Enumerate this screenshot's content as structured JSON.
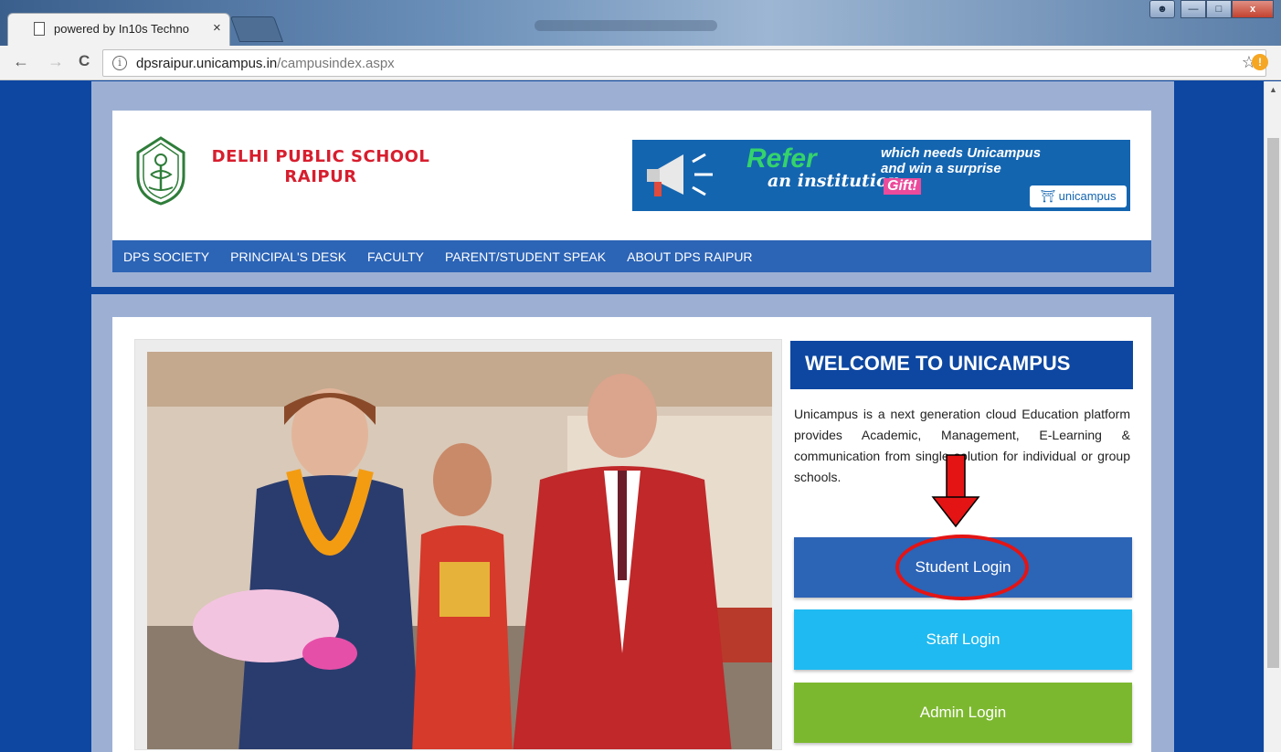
{
  "browser": {
    "tab_title": "powered by In10s Techno",
    "tab_close": "×",
    "url_domain": "dpsraipur.unicampus.in",
    "url_path": "/campusindex.aspx",
    "back": "←",
    "forward": "→",
    "reload": "C",
    "star": "☆",
    "alert": "!"
  },
  "header": {
    "school_line1": "DELHI PUBLIC SCHOOL",
    "school_line2": "RAIPUR"
  },
  "banner": {
    "refer": "Refer",
    "institution": "an institution",
    "line1": "which needs Unicampus",
    "line2": "and win a surprise",
    "gift": "Gift!",
    "brand": "unicampus"
  },
  "nav": [
    "DPS SOCIETY",
    "PRINCIPAL'S DESK",
    "FACULTY",
    "PARENT/STUDENT SPEAK",
    "ABOUT DPS RAIPUR"
  ],
  "welcome": {
    "title": "WELCOME TO UNICAMPUS",
    "description": "Unicampus is a next generation cloud Education platform provides Academic, Management, E-Learning & communication from single solution for individual or group schools."
  },
  "buttons": {
    "student": "Student Login",
    "staff": "Staff Login",
    "admin": "Admin Login"
  },
  "colors": {
    "page_bg": "#0d47a1",
    "panel": "#9db0d4",
    "nav": "#2c64b6",
    "student_btn": "#2c64b6",
    "staff_btn": "#1fbaf1",
    "admin_btn": "#7cb82f",
    "annotation": "#e41414",
    "school_red": "#d71e2e"
  }
}
